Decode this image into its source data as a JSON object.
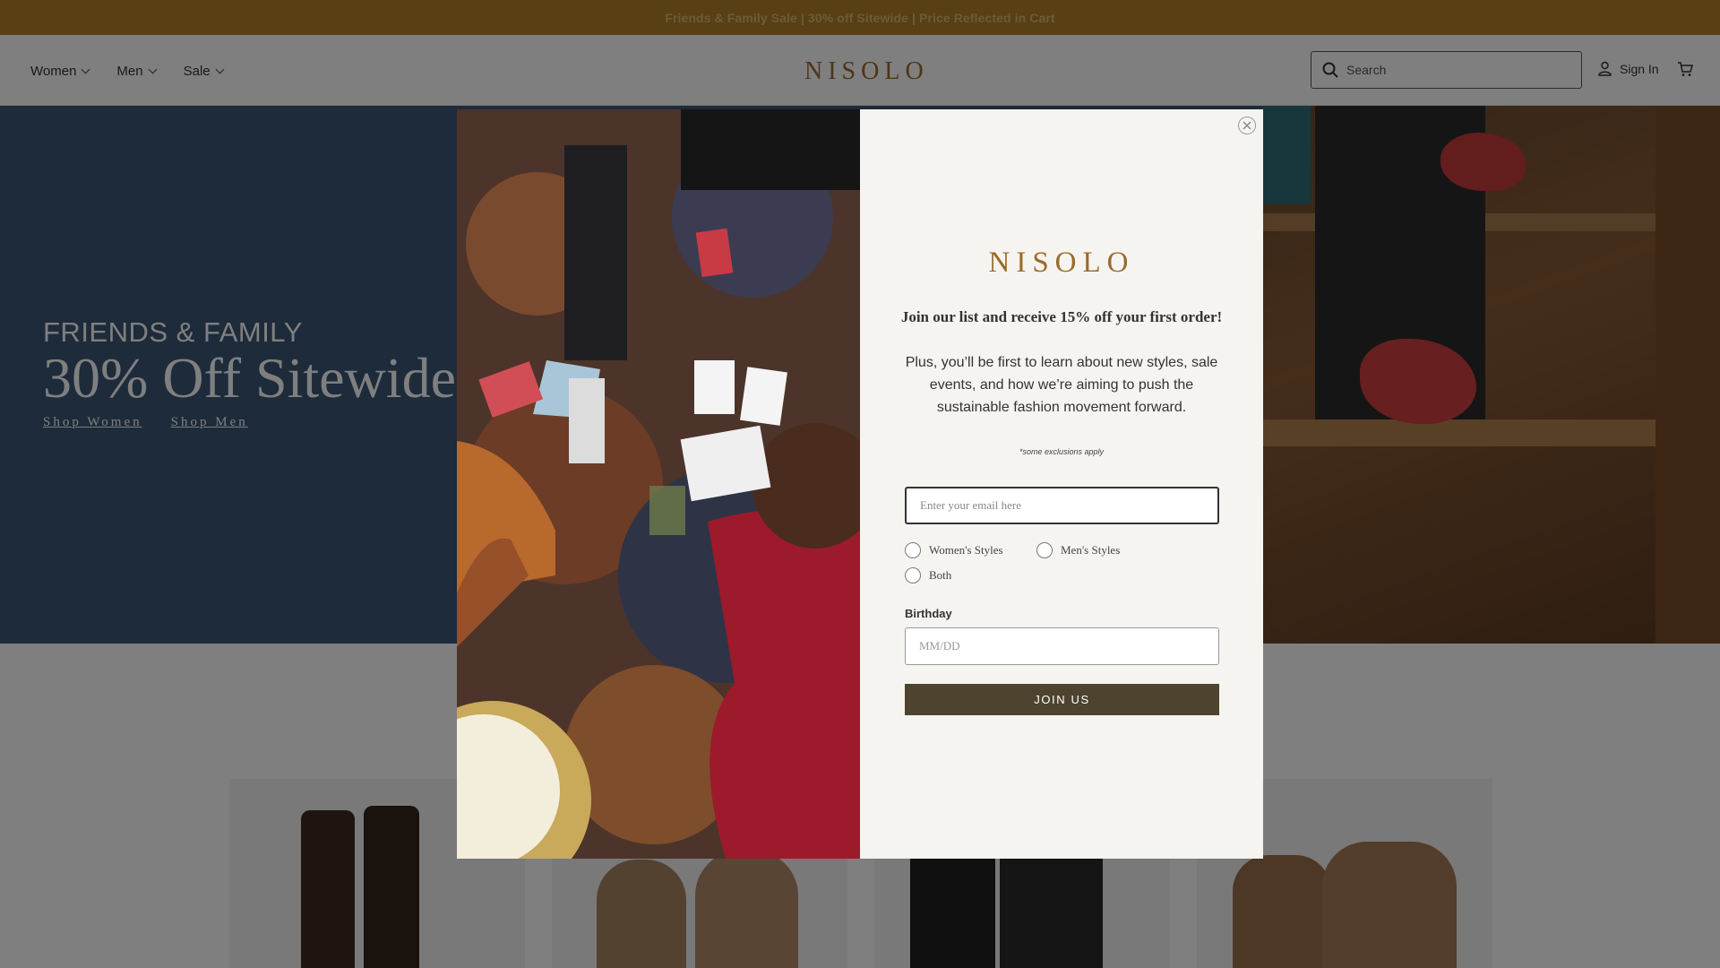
{
  "announcement": {
    "text": "Friends & Family Sale | 30% off Sitewide | Price Reflected in Cart"
  },
  "header": {
    "nav": [
      {
        "label": "Women"
      },
      {
        "label": "Men"
      },
      {
        "label": "Sale"
      }
    ],
    "logo": "NISOLO",
    "search": {
      "placeholder": "Search"
    },
    "sign_in": "Sign In"
  },
  "hero": {
    "eyebrow": "FRIENDS & FAMILY",
    "title": "30% Off Sitewide",
    "links": [
      "Shop Women",
      "Shop Men"
    ]
  },
  "modal": {
    "logo": "NISOLO",
    "headline": "Join our list and receive 15% off your first order!",
    "body": "Plus, you’ll be first to learn about new styles, sale events, and how we’re aiming to push the sustainable fashion movement forward.",
    "note": "*some exclusions apply",
    "email_placeholder": "Enter your email here",
    "style_options": [
      "Women's Styles",
      "Men's Styles",
      "Both"
    ],
    "birthday_label": "Birthday",
    "birthday_placeholder": "MM/DD",
    "cta": "JOIN US"
  },
  "colors": {
    "announcement_bg": "#b07f28",
    "brand": "#9a6a2d",
    "hero_bg": "#3b5677",
    "cta_bg": "#4e432e",
    "modal_bg": "#f6f4f0"
  },
  "icons": [
    "chevron-down-icon",
    "search-icon",
    "user-icon",
    "cart-icon",
    "close-icon"
  ]
}
